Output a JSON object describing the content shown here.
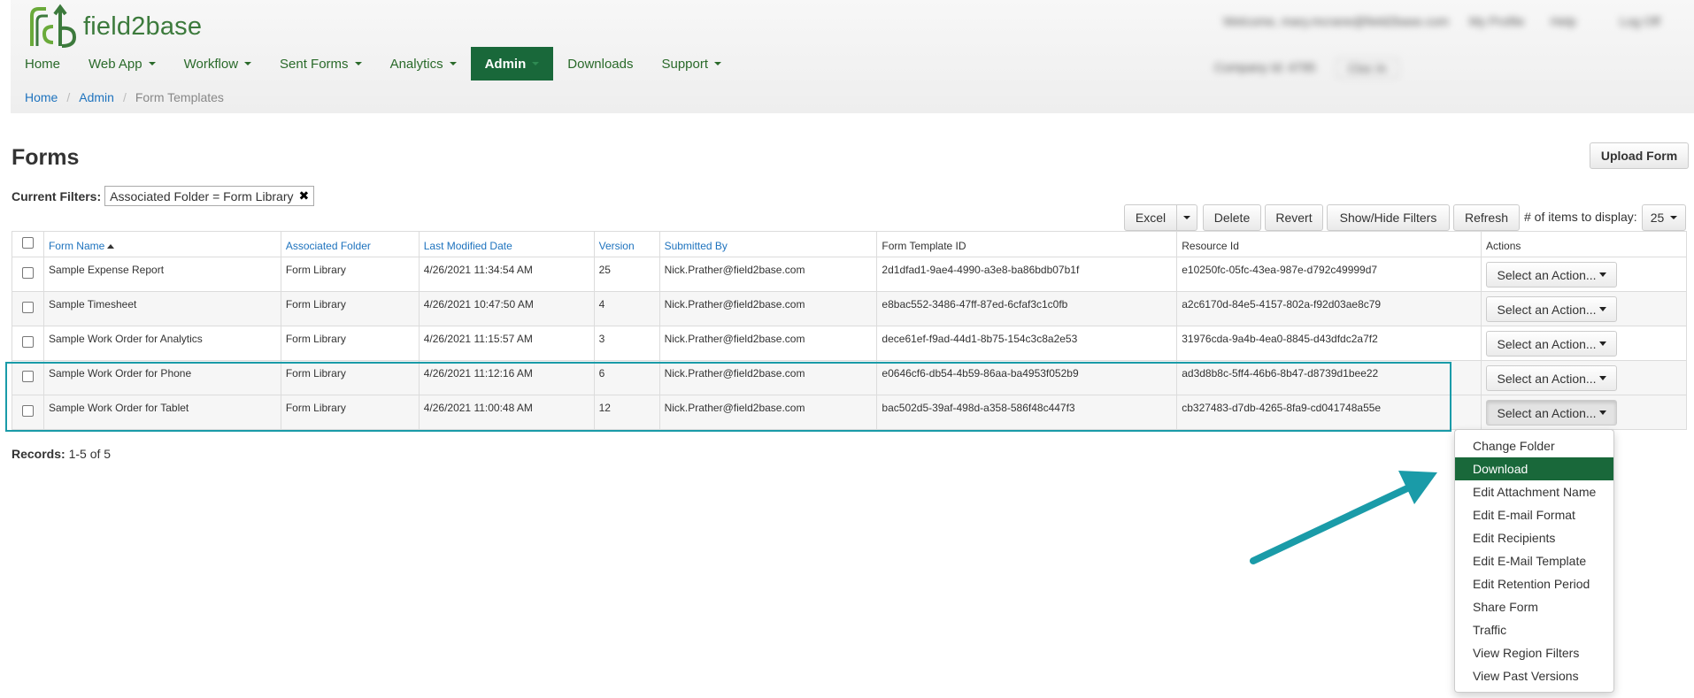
{
  "app": {
    "logo_text": "field2base"
  },
  "topright_blurred": {
    "welcome": "Welcome, mary.mcrane@field2base.com",
    "profile": "My Profile",
    "help": "Help",
    "logout": "Log Off",
    "company": "Company Id: 4795",
    "clock": "Cloc In"
  },
  "nav": [
    {
      "label": "Home",
      "caret": false
    },
    {
      "label": "Web App",
      "caret": true
    },
    {
      "label": "Workflow",
      "caret": true
    },
    {
      "label": "Sent Forms",
      "caret": true
    },
    {
      "label": "Analytics",
      "caret": true
    },
    {
      "label": "Admin",
      "caret": true,
      "active": true
    },
    {
      "label": "Downloads",
      "caret": false
    },
    {
      "label": "Support",
      "caret": true
    }
  ],
  "breadcrumb": {
    "home": "Home",
    "admin": "Admin",
    "current": "Form Templates"
  },
  "page": {
    "title": "Forms",
    "upload_button": "Upload Form"
  },
  "filters": {
    "label": "Current Filters:",
    "tag": "Associated Folder = Form Library"
  },
  "toolbar": {
    "excel": "Excel",
    "delete": "Delete",
    "revert": "Revert",
    "show_hide": "Show/Hide Filters",
    "refresh": "Refresh",
    "items_label": "# of items to display:",
    "items_value": "25"
  },
  "table": {
    "headers": {
      "name": "Form Name",
      "folder": "Associated Folder",
      "modified": "Last Modified Date",
      "version": "Version",
      "submitted": "Submitted By",
      "template_id": "Form Template ID",
      "resource_id": "Resource Id",
      "actions": "Actions"
    },
    "action_label": "Select an Action...",
    "rows": [
      {
        "name": "Sample Expense Report",
        "folder": "Form Library",
        "modified": "4/26/2021 11:34:54 AM",
        "version": "25",
        "submitted": "Nick.Prather@field2base.com",
        "template_id": "2d1dfad1-9ae4-4990-a3e8-ba86bdb07b1f",
        "resource_id": "e10250fc-05fc-43ea-987e-d792c49999d7"
      },
      {
        "name": "Sample Timesheet",
        "folder": "Form Library",
        "modified": "4/26/2021 10:47:50 AM",
        "version": "4",
        "submitted": "Nick.Prather@field2base.com",
        "template_id": "e8bac552-3486-47ff-87ed-6cfaf3c1c0fb",
        "resource_id": "a2c6170d-84e5-4157-802a-f92d03ae8c79"
      },
      {
        "name": "Sample Work Order for Analytics",
        "folder": "Form Library",
        "modified": "4/26/2021 11:15:57 AM",
        "version": "3",
        "submitted": "Nick.Prather@field2base.com",
        "template_id": "dece61ef-f9ad-44d1-8b75-154c3c8a2e53",
        "resource_id": "31976cda-9a4b-4ea0-8845-d43dfdc2a7f2"
      },
      {
        "name": "Sample Work Order for Phone",
        "folder": "Form Library",
        "modified": "4/26/2021 11:12:16 AM",
        "version": "6",
        "submitted": "Nick.Prather@field2base.com",
        "template_id": "e0646cf6-db54-4b59-86aa-ba4953f052b9",
        "resource_id": "ad3d8b8c-5ff4-46b6-8b47-d8739d1bee22"
      },
      {
        "name": "Sample Work Order for Tablet",
        "folder": "Form Library",
        "modified": "4/26/2021 11:00:48 AM",
        "version": "12",
        "submitted": "Nick.Prather@field2base.com",
        "template_id": "bac502d5-39af-498d-a358-586f48c447f3",
        "resource_id": "cb327483-d7db-4265-8fa9-cd041748a55e"
      }
    ]
  },
  "records": {
    "label": "Records:",
    "value": "1-5 of 5"
  },
  "dropdown": {
    "items": [
      "Change Folder",
      "Download",
      "Edit Attachment Name",
      "Edit E-mail Format",
      "Edit Recipients",
      "Edit E-Mail Template",
      "Edit Retention Period",
      "Share Form",
      "Traffic",
      "View Region Filters",
      "View Past Versions"
    ],
    "active_index": 1
  },
  "colors": {
    "brand_green": "#19683a",
    "link_blue": "#1e73be",
    "highlight_teal": "#1a9ba8"
  }
}
